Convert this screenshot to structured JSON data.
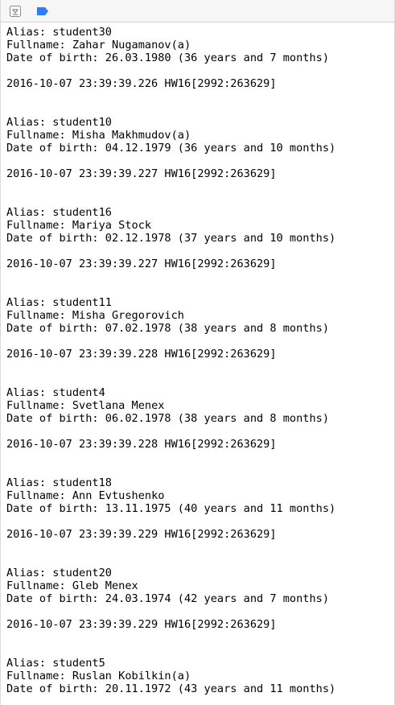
{
  "toolbar": {
    "icons": [
      "hide-console-icon",
      "breakpoint-icon"
    ],
    "colors": {
      "breakpoint": "#2f7cf6",
      "icon_stroke": "#8a8a8a"
    }
  },
  "labels": {
    "alias": "Alias:",
    "fullname": "Fullname:",
    "dob": "Date of birth:"
  },
  "entries": [
    {
      "alias": "student30",
      "fullname": "Zahar Nugamanov(a)",
      "dob": "26.03.1980 (36 years and 7 months)",
      "log": "2016-10-07 23:39:39.226 HW16[2992:263629]"
    },
    {
      "alias": "student10",
      "fullname": "Misha Makhmudov(a)",
      "dob": "04.12.1979 (36 years and 10 months)",
      "log": "2016-10-07 23:39:39.227 HW16[2992:263629]"
    },
    {
      "alias": "student16",
      "fullname": "Mariya Stock",
      "dob": "02.12.1978 (37 years and 10 months)",
      "log": "2016-10-07 23:39:39.227 HW16[2992:263629]"
    },
    {
      "alias": "student11",
      "fullname": "Misha Gregorovich",
      "dob": "07.02.1978 (38 years and 8 months)",
      "log": "2016-10-07 23:39:39.228 HW16[2992:263629]"
    },
    {
      "alias": "student4",
      "fullname": "Svetlana Menex",
      "dob": "06.02.1978 (38 years and 8 months)",
      "log": "2016-10-07 23:39:39.228 HW16[2992:263629]"
    },
    {
      "alias": "student18",
      "fullname": "Ann Evtushenko",
      "dob": "13.11.1975 (40 years and 11 months)",
      "log": "2016-10-07 23:39:39.229 HW16[2992:263629]"
    },
    {
      "alias": "student20",
      "fullname": "Gleb Menex",
      "dob": "24.03.1974 (42 years and 7 months)",
      "log": "2016-10-07 23:39:39.229 HW16[2992:263629]"
    },
    {
      "alias": "student5",
      "fullname": "Ruslan Kobilkin(a)",
      "dob": "20.11.1972 (43 years and 11 months)",
      "log": ""
    }
  ]
}
